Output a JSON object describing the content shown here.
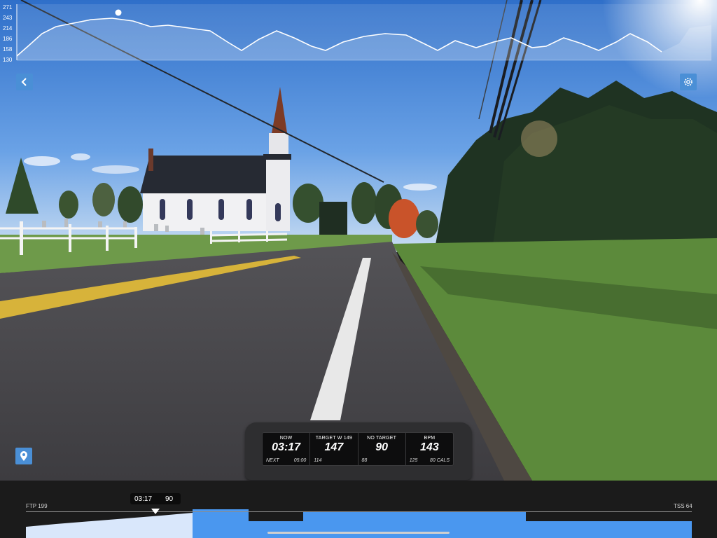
{
  "elevation": {
    "y_ticks": [
      "271",
      "243",
      "214",
      "186",
      "158",
      "130"
    ]
  },
  "controls": {
    "back_icon": "chevron-left-icon",
    "settings_icon": "gear-icon",
    "location_icon": "map-pin-icon"
  },
  "metrics": [
    {
      "label": "NOW",
      "value": "03:17",
      "sub_left": "NEXT",
      "sub_right": "05:00"
    },
    {
      "label": "TARGET W 149",
      "value": "147",
      "sub_left": "114",
      "sub_right": ""
    },
    {
      "label": "NO TARGET",
      "value": "90",
      "sub_left": "88",
      "sub_right": ""
    },
    {
      "label": "BPM",
      "value": "143",
      "sub_left": "125",
      "sub_right": "80 CALS"
    }
  ],
  "workout": {
    "time": "03:17",
    "cadence": "90",
    "ftp_label": "FTP 199",
    "tss_label": "TSS 64",
    "accent_color": "#4a97ef"
  }
}
